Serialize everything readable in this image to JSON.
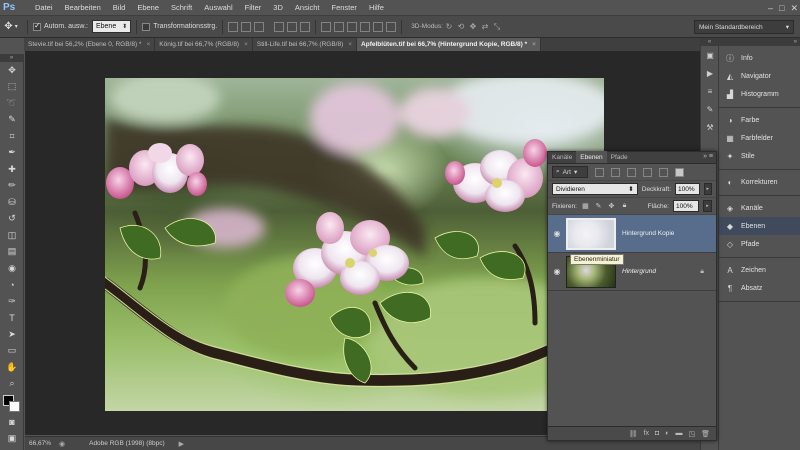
{
  "app": {
    "logo": "Ps"
  },
  "menubar": {
    "items": [
      "Datei",
      "Bearbeiten",
      "Bild",
      "Ebene",
      "Schrift",
      "Auswahl",
      "Filter",
      "3D",
      "Ansicht",
      "Fenster",
      "Hilfe"
    ],
    "window_controls": [
      "–",
      "□",
      "✕"
    ]
  },
  "options": {
    "auto_select_label": "Autom. ausw.:",
    "auto_select_checked": true,
    "auto_select_target": "Ebene",
    "transform_label": "Transformationsstrg.",
    "transform_checked": false,
    "mode3d_label": "3D-Modus:",
    "workspace": "Mein Standardbereich"
  },
  "doc_tabs": [
    {
      "label": "Stevie.tif bei 56,2% (Ebene 0, RGB/8) *",
      "active": false
    },
    {
      "label": "König.tif bei 66,7% (RGB/8)",
      "active": false
    },
    {
      "label": "Still-Life.tif bei 66,7% (RGB/8)",
      "active": false
    },
    {
      "label": "Apfelblüten.tif bei 66,7% (Hintergrund Kopie, RGB/8) *",
      "active": true
    }
  ],
  "doc_tab_close": "×",
  "status": {
    "zoom": "66,67%",
    "info": "Adobe RGB (1998) (8bpc)",
    "arrow": "▶"
  },
  "layers_panel": {
    "tabs": [
      "Kanäle",
      "Ebenen",
      "Pfade"
    ],
    "active_tab": "Ebenen",
    "filter_kind": "Art",
    "blend_mode": "Dividieren",
    "opacity_label": "Deckkraft:",
    "opacity": "100%",
    "lock_label": "Fixieren:",
    "fill_label": "Fläche:",
    "fill": "100%",
    "layers": [
      {
        "name": "Hintergrund Kopie",
        "selected": true,
        "italic": false,
        "locked": false
      },
      {
        "name": "Hintergrund",
        "selected": false,
        "italic": true,
        "locked": true
      }
    ],
    "tooltip": "Ebenenminiatur"
  },
  "right_dock": {
    "groups": [
      [
        {
          "label": "Info",
          "icon": "info-icon",
          "glyph": "ⓘ"
        },
        {
          "label": "Navigator",
          "icon": "navigator-icon",
          "glyph": "◭"
        },
        {
          "label": "Histogramm",
          "icon": "histogram-icon",
          "glyph": "▟"
        }
      ],
      [
        {
          "label": "Farbe",
          "icon": "color-icon",
          "glyph": "◑"
        },
        {
          "label": "Farbfelder",
          "icon": "swatches-icon",
          "glyph": "▦"
        },
        {
          "label": "Stile",
          "icon": "styles-icon",
          "glyph": "✦"
        }
      ],
      [
        {
          "label": "Korrekturen",
          "icon": "adjustments-icon",
          "glyph": "◐"
        }
      ],
      [
        {
          "label": "Kanäle",
          "icon": "channels-icon",
          "glyph": "◈"
        },
        {
          "label": "Ebenen",
          "icon": "layers-icon",
          "glyph": "◆",
          "active": true
        },
        {
          "label": "Pfade",
          "icon": "paths-icon",
          "glyph": "◇"
        }
      ],
      [
        {
          "label": "Zeichen",
          "icon": "character-icon",
          "glyph": "A"
        },
        {
          "label": "Absatz",
          "icon": "paragraph-icon",
          "glyph": "¶"
        }
      ]
    ]
  },
  "tools": [
    {
      "name": "move-tool-icon",
      "glyph": "✥"
    },
    {
      "name": "marquee-tool-icon",
      "glyph": "⬚"
    },
    {
      "name": "lasso-tool-icon",
      "glyph": "➰"
    },
    {
      "name": "quick-select-tool-icon",
      "glyph": "✎"
    },
    {
      "name": "crop-tool-icon",
      "glyph": "⌗"
    },
    {
      "name": "eyedropper-tool-icon",
      "glyph": "✒"
    },
    {
      "name": "healing-brush-tool-icon",
      "glyph": "✚"
    },
    {
      "name": "brush-tool-icon",
      "glyph": "✏"
    },
    {
      "name": "clone-stamp-tool-icon",
      "glyph": "⛁"
    },
    {
      "name": "history-brush-tool-icon",
      "glyph": "↺"
    },
    {
      "name": "eraser-tool-icon",
      "glyph": "◫"
    },
    {
      "name": "gradient-tool-icon",
      "glyph": "▤"
    },
    {
      "name": "blur-tool-icon",
      "glyph": "◉"
    },
    {
      "name": "dodge-tool-icon",
      "glyph": "◔"
    },
    {
      "name": "pen-tool-icon",
      "glyph": "✑"
    },
    {
      "name": "type-tool-icon",
      "glyph": "T"
    },
    {
      "name": "path-select-tool-icon",
      "glyph": "➤"
    },
    {
      "name": "shape-tool-icon",
      "glyph": "▭"
    },
    {
      "name": "hand-tool-icon",
      "glyph": "✋"
    },
    {
      "name": "zoom-tool-icon",
      "glyph": "⌕"
    }
  ],
  "icon_strip": [
    {
      "name": "history-icon",
      "glyph": "▣"
    },
    {
      "name": "actions-icon",
      "glyph": "▶"
    },
    {
      "name": "properties-icon",
      "glyph": "≡"
    },
    {
      "name": "brush-presets-icon",
      "glyph": "✎"
    },
    {
      "name": "tool-presets-icon",
      "glyph": "⚒"
    }
  ],
  "colors": {
    "accent_selected_layer": "#586c8c",
    "panel_bg": "#535353",
    "canvas_bg": "#282828"
  }
}
